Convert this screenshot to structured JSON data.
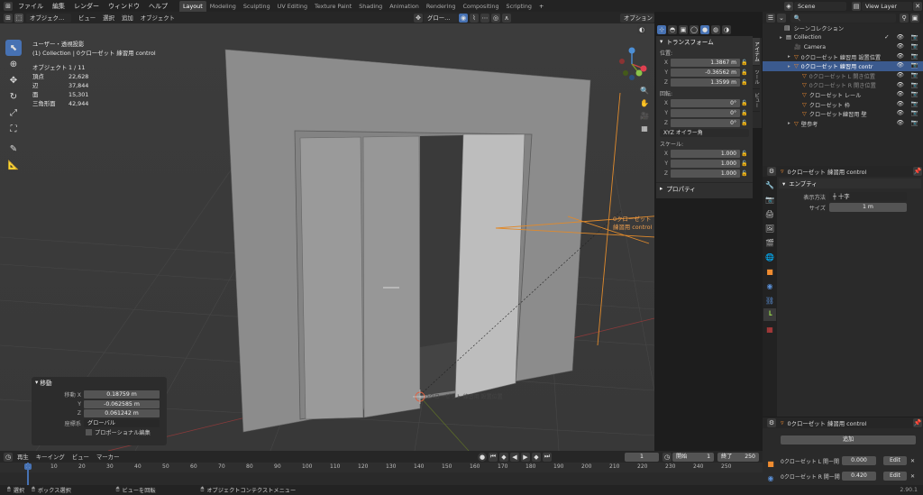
{
  "menubar": {
    "items": [
      "ファイル",
      "編集",
      "レンダー",
      "ウィンドウ",
      "ヘルプ"
    ],
    "workspaces": [
      "Layout",
      "Modeling",
      "Sculpting",
      "UV Editing",
      "Texture Paint",
      "Shading",
      "Animation",
      "Rendering",
      "Compositing",
      "Scripting"
    ],
    "scene": "Scene",
    "view_layer": "View Layer"
  },
  "viewport_header": {
    "mode": "オブジェク…",
    "menus": [
      "ビュー",
      "選択",
      "追加",
      "オブジェクト"
    ],
    "transform_orient": "グロー…",
    "options": "オプション"
  },
  "viewport_info": {
    "view": "ユーザー・透視投影",
    "collection": "(1) Collection | 0クローゼット 練習用 control",
    "stats": [
      {
        "k": "オブジェクト",
        "v": "1 / 11"
      },
      {
        "k": "頂点",
        "v": "22,628"
      },
      {
        "k": "辺",
        "v": "37,844"
      },
      {
        "k": "面",
        "v": "15,301"
      },
      {
        "k": "三角形面",
        "v": "42,944"
      }
    ]
  },
  "object_label": "0クローゼット 練習用 control",
  "object_label2": "0クローゼット 練習用 設置位置",
  "npanel": {
    "transform_title": "トランスフォーム",
    "location": "位置:",
    "loc": [
      {
        "a": "X",
        "v": "1.3867 m"
      },
      {
        "a": "Y",
        "v": "-0.36562 m"
      },
      {
        "a": "Z",
        "v": "1.3599 m"
      }
    ],
    "rotation": "回転:",
    "rot": [
      {
        "a": "X",
        "v": "0°"
      },
      {
        "a": "Y",
        "v": "0°"
      },
      {
        "a": "Z",
        "v": "0°"
      }
    ],
    "rot_mode": "XYZ オイラー角",
    "scale": "スケール:",
    "scl": [
      {
        "a": "X",
        "v": "1.000"
      },
      {
        "a": "Y",
        "v": "1.000"
      },
      {
        "a": "Z",
        "v": "1.000"
      }
    ],
    "props_title": "プロパティ"
  },
  "sidebar_tabs": [
    "アイテム",
    "ツール",
    "ビュー"
  ],
  "operator": {
    "title": "移動",
    "rows": [
      {
        "l": "移動 X",
        "v": "0.18759 m"
      },
      {
        "l": "Y",
        "v": "-0.062585 m"
      },
      {
        "l": "Z",
        "v": "0.061242 m"
      }
    ],
    "orient_label": "座標系",
    "orient": "グローバル",
    "proportional": "プロポーショナル編集"
  },
  "outliner": {
    "root": "シーンコレクション",
    "rows": [
      {
        "n": "Collection",
        "d": 1,
        "c": "#d0d0d0"
      },
      {
        "n": "Camera",
        "d": 2,
        "c": "#d0d0d0"
      },
      {
        "n": "0クローゼット 練習用 設置位置",
        "d": 2,
        "c": "#d0d0d0"
      },
      {
        "n": "0クローゼット 練習用 contr",
        "d": 2,
        "c": "#ffffff",
        "sel": true
      },
      {
        "n": "0クローゼット L 開き位置",
        "d": 3,
        "c": "#8a8a8a"
      },
      {
        "n": "0クローゼット R 開き位置",
        "d": 3,
        "c": "#8a8a8a"
      },
      {
        "n": "クローゼット レール",
        "d": 3,
        "c": "#d0d0d0"
      },
      {
        "n": "クローゼット 枠",
        "d": 3,
        "c": "#d0d0d0"
      },
      {
        "n": "クローゼット練習用 壁",
        "d": 3,
        "c": "#d0d0d0"
      },
      {
        "n": "壁参考",
        "d": 2,
        "c": "#d0d0d0"
      }
    ]
  },
  "properties": {
    "object": "0クローゼット 練習用 control",
    "panel": "エンプティ",
    "display_label": "表示方法",
    "display": "十字",
    "size_label": "サイズ",
    "size": "1 m"
  },
  "drivers": {
    "object": "0クローゼット 練習用 control",
    "add": "追加",
    "rows": [
      {
        "l": "0クローゼット L 開ー開",
        "v": "0.000",
        "b": "Edit"
      },
      {
        "l": "0クローゼット R 開ー開",
        "v": "0.420",
        "b": "Edit"
      }
    ]
  },
  "timeline": {
    "menus": [
      "再生",
      "キーイング",
      "ビュー",
      "マーカー"
    ],
    "frame": "1",
    "start_label": "開始",
    "start": "1",
    "end_label": "終了",
    "end": "250",
    "ticks": [
      "1",
      "10",
      "20",
      "30",
      "40",
      "50",
      "60",
      "70",
      "80",
      "90",
      "100",
      "110",
      "120",
      "130",
      "140",
      "150",
      "160",
      "170",
      "180",
      "190",
      "200",
      "210",
      "220",
      "230",
      "240",
      "250"
    ]
  },
  "statusbar": {
    "items": [
      "選択",
      "ボックス選択",
      "ビューを回転",
      "オブジェクトコンテクストメニュー"
    ],
    "version": "2.90.1"
  }
}
